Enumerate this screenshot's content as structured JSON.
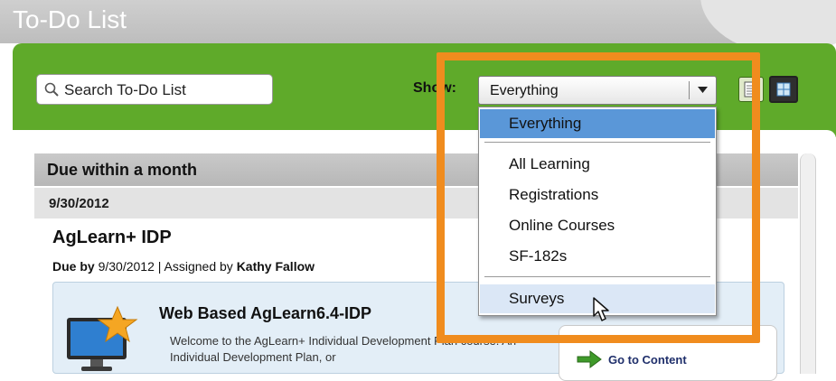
{
  "header": {
    "title": "To-Do List"
  },
  "search": {
    "placeholder": "Search To-Do List"
  },
  "show": {
    "label": "Show:",
    "selected": "Everything",
    "options": [
      "Everything",
      "All Learning",
      "Registrations",
      "Online Courses",
      "SF-182s",
      "Surveys"
    ],
    "highlighted_option": "Surveys"
  },
  "group": {
    "heading": "Due within a month",
    "date": "9/30/2012"
  },
  "item": {
    "title": "AgLearn+ IDP",
    "due_prefix": "Due by",
    "due_date": "9/30/2012",
    "assigned_prefix": "| Assigned by",
    "assigned_by": "Kathy Fallow"
  },
  "course": {
    "title": "Web Based  AgLearn6.4-IDP",
    "description": "Welcome to the AgLearn+ Individual Development Plan course. An Individual Development Plan, or",
    "action": "Go to Content",
    "icon": "monitor-star-icon"
  },
  "colors": {
    "toolbar": "#5faa2a",
    "highlight_frame": "#f08c1e",
    "selected_option": "#5a97d8"
  }
}
